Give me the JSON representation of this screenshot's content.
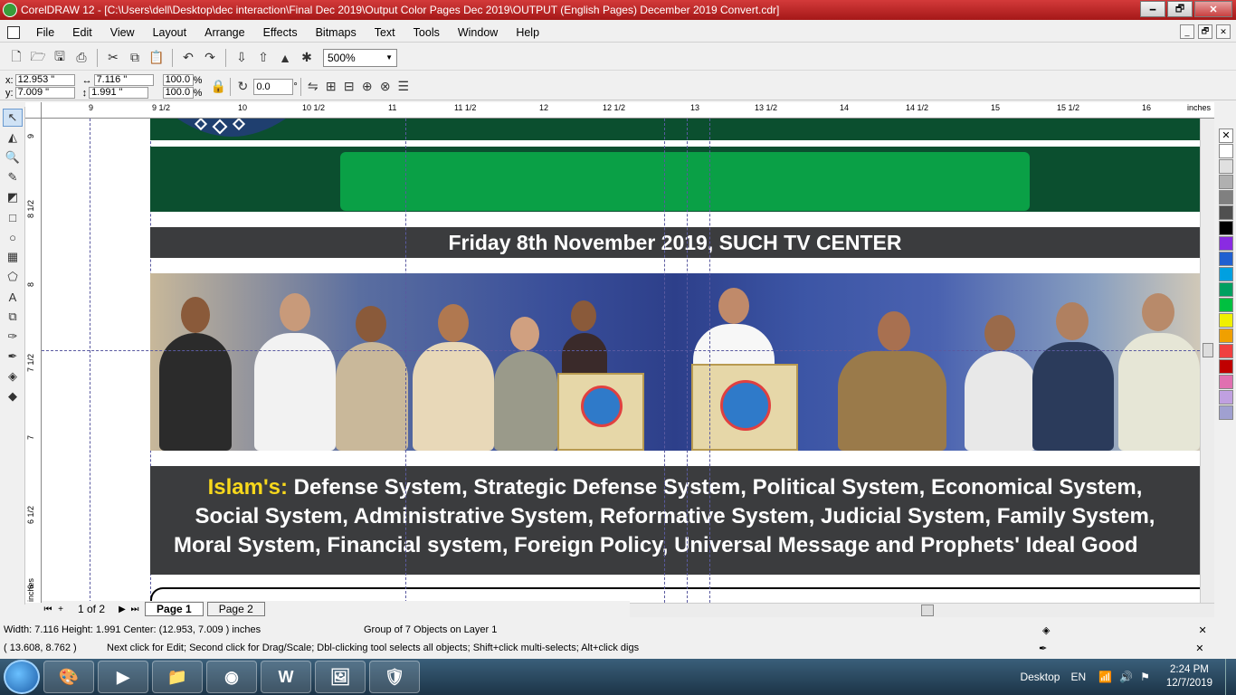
{
  "title_bar": {
    "title": "CorelDRAW 12 - [C:\\Users\\dell\\Desktop\\dec interaction\\Final Dec 2019\\Output Color Pages Dec 2019\\OUTPUT (English Pages) December 2019 Convert.cdr]",
    "min": "🗕",
    "max": "🗗",
    "close": "✕"
  },
  "menu": [
    "File",
    "Edit",
    "View",
    "Layout",
    "Arrange",
    "Effects",
    "Bitmaps",
    "Text",
    "Tools",
    "Window",
    "Help"
  ],
  "mdi_buttons": [
    "_",
    "🗗",
    "✕"
  ],
  "toolbar": {
    "zoom": "500%"
  },
  "property_bar": {
    "x": "12.953 \"",
    "y": "7.009 \"",
    "width": "7.116 \"",
    "height": "1.991 \"",
    "scale_x": "100.0",
    "scale_y": "100.0",
    "pct": "%",
    "rotation": "0.0",
    "degree": "°"
  },
  "ruler_top": [
    {
      "label": "9",
      "pos": 52
    },
    {
      "label": "9 1/2",
      "pos": 122
    },
    {
      "label": "10",
      "pos": 217
    },
    {
      "label": "10 1/2",
      "pos": 288
    },
    {
      "label": "11",
      "pos": 383
    },
    {
      "label": "11 1/2",
      "pos": 456
    },
    {
      "label": "12",
      "pos": 550
    },
    {
      "label": "12 1/2",
      "pos": 620
    },
    {
      "label": "13",
      "pos": 717
    },
    {
      "label": "13 1/2",
      "pos": 788
    },
    {
      "label": "14",
      "pos": 882
    },
    {
      "label": "14 1/2",
      "pos": 955
    },
    {
      "label": "15",
      "pos": 1049
    },
    {
      "label": "15 1/2",
      "pos": 1122
    },
    {
      "label": "16",
      "pos": 1216
    },
    {
      "label": "inches",
      "pos": 1266
    }
  ],
  "ruler_left": [
    {
      "label": "9",
      "pos": 12
    },
    {
      "label": "8 1/2",
      "pos": 100
    },
    {
      "label": "8",
      "pos": 176
    },
    {
      "label": "7 1/2",
      "pos": 270
    },
    {
      "label": "7",
      "pos": 345
    },
    {
      "label": "6 1/2",
      "pos": 438
    },
    {
      "label": "6",
      "pos": 510
    }
  ],
  "ruler_unit_left": "inches",
  "document": {
    "date_line": "Friday 8th November 2019, SUCH TV CENTER",
    "topics_prefix": "Islam's:",
    "topics_line1": " Defense System, Strategic Defense System, Political System, Economical System,",
    "topics_line2": "Social System,  Administrative System, Reformative System, Judicial System, Family System,",
    "topics_line3": "Moral System,  Financial system, Foreign Policy,  Universal Message and Prophets' Ideal Good"
  },
  "palette_colors": [
    "#ffffff",
    "#e0e0e0",
    "#b0b0b0",
    "#808080",
    "#505050",
    "#000000",
    "#8a2be2",
    "#2060d0",
    "#00a0e0",
    "#00a060",
    "#00c040",
    "#f0f000",
    "#f0a000",
    "#f04040",
    "#c00000",
    "#e070b0",
    "#c0a0e0",
    "#a0a0d0"
  ],
  "pager": {
    "count": "1 of 2",
    "tabs": [
      "Page 1",
      "Page 2"
    ],
    "active": 0
  },
  "status": {
    "dims": "Width: 7.116  Height: 1.991  Center: (12.953, 7.009 )  inches",
    "selection": "Group of 7 Objects on Layer 1",
    "coords": "( 13.608, 8.762 )",
    "hint": "Next click for Edit; Second click for Drag/Scale; Dbl-clicking tool selects all objects; Shift+click multi-selects; Alt+click digs"
  },
  "taskbar": {
    "desktop_label": "Desktop",
    "lang": "EN",
    "time": "2:24 PM",
    "date": "12/7/2019",
    "apps": [
      "paint-icon",
      "media-player-icon",
      "file-explorer-icon",
      "chrome-icon",
      "word-icon",
      "image-viewer-icon",
      "security-icon"
    ]
  }
}
